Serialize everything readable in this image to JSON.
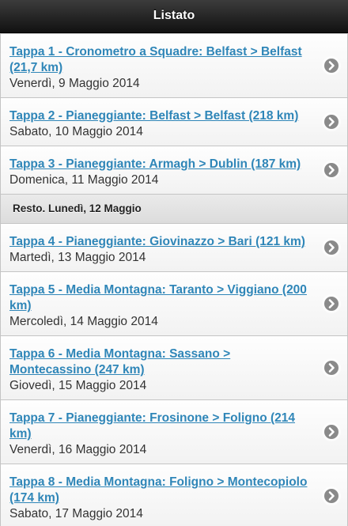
{
  "header": {
    "title": "Listato"
  },
  "group1": [
    {
      "title": "Tappa 1 - Cronometro a Squadre: Belfast > Belfast (21,7 km)",
      "date": "Venerdì, 9 Maggio 2014"
    },
    {
      "title": "Tappa 2 - Pianeggiante: Belfast > Belfast (218 km)",
      "date": "Sabato, 10 Maggio 2014"
    },
    {
      "title": "Tappa 3 - Pianeggiante: Armagh > Dublin (187 km)",
      "date": "Domenica, 11 Maggio 2014"
    }
  ],
  "divider": {
    "label": "Resto. Lunedì, 12 Maggio"
  },
  "group2": [
    {
      "title": "Tappa 4 - Pianeggiante: Giovinazzo > Bari (121 km)",
      "date": "Martedì, 13 Maggio 2014"
    },
    {
      "title": "Tappa 5 - Media Montagna: Taranto > Viggiano (200 km)",
      "date": "Mercoledì, 14 Maggio 2014"
    },
    {
      "title": "Tappa 6 - Media Montagna: Sassano > Montecassino (247 km)",
      "date": "Giovedì, 15 Maggio 2014"
    },
    {
      "title": "Tappa 7 - Pianeggiante: Frosinone > Foligno (214 km)",
      "date": "Venerdì, 16 Maggio 2014"
    },
    {
      "title": "Tappa 8 - Media Montagna: Foligno > Montecopiolo (174 km)",
      "date": "Sabato, 17 Maggio 2014"
    }
  ],
  "icons": {
    "row_arrow": "chevron-right-circle-icon"
  },
  "colors": {
    "header_bg": "#1e1e1e",
    "link": "#2f86b8",
    "arrow_bg": "#8a8a8a"
  }
}
